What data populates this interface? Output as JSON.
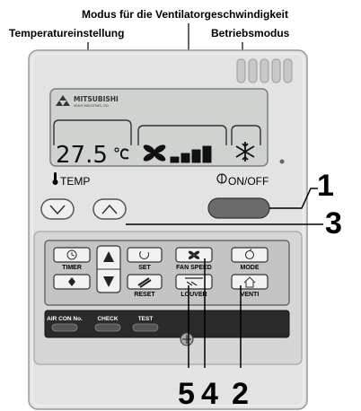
{
  "callouts": {
    "fan_speed_mode": "Modus für die Ventilatorgeschwindigkeit",
    "temperature_setting": "Temperatureinstellung",
    "operating_mode": "Betriebsmodus"
  },
  "brand": {
    "name": "MITSUBISHI",
    "sub": "HEAVY INDUSTRIES, LTD."
  },
  "display": {
    "temperature": "27.5",
    "unit_icon": "celsius-icon",
    "fan_speed_level": 4,
    "fan_speed_max": 4,
    "mode_icon": "snowflake-icon"
  },
  "panel_labels": {
    "temp": "TEMP",
    "on_off": "ON/OFF"
  },
  "buttons": {
    "timer": "TIMER",
    "set": "SET",
    "reset": "RESET",
    "fan_speed": "FAN SPEED",
    "mode": "MODE",
    "louver": "LOUVER",
    "venti": "VENTI",
    "air_con_no": "AIR CON No.",
    "check": "CHECK",
    "test": "TEST"
  },
  "numbers": {
    "n1": "1",
    "n3": "3",
    "n5": "5",
    "n4": "4",
    "n2": "2"
  }
}
